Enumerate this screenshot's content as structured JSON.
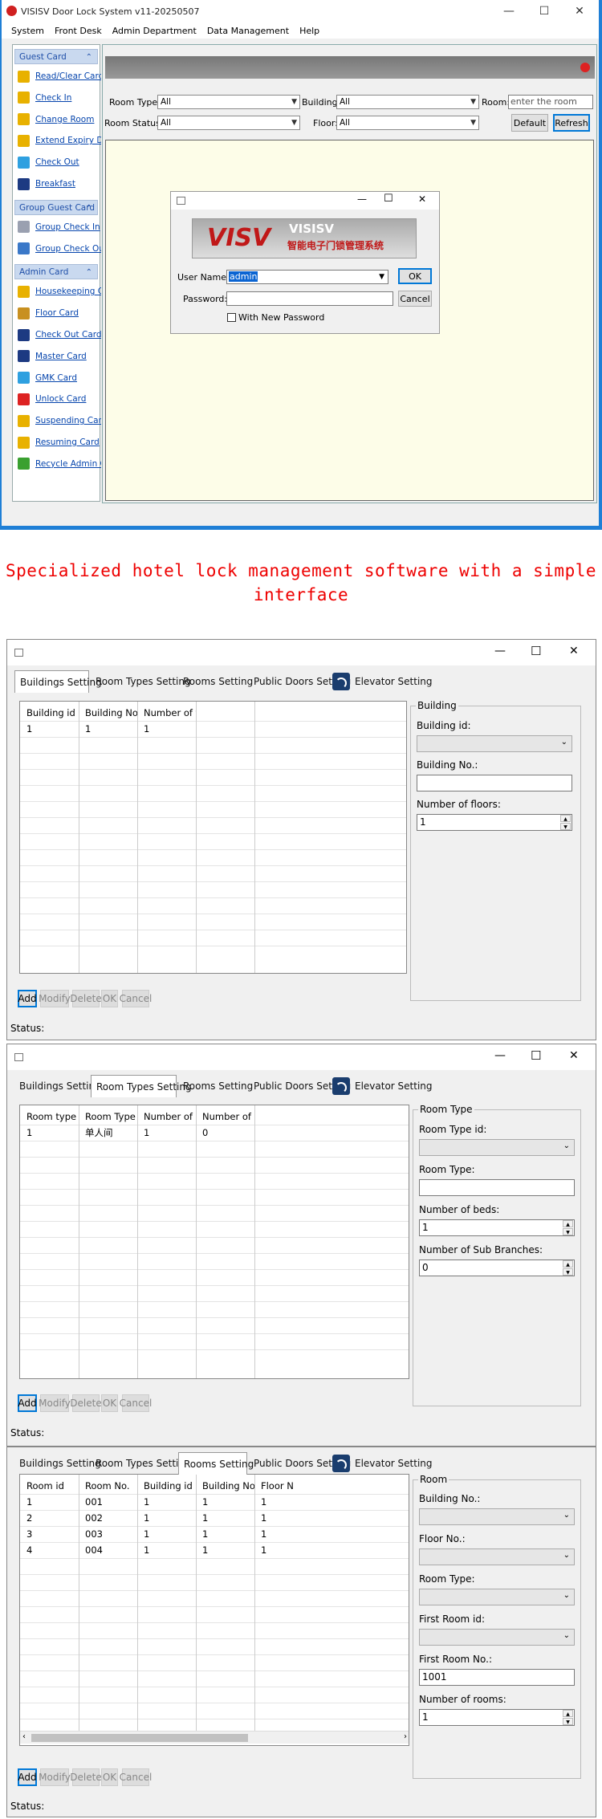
{
  "main_window": {
    "title": "VISISV Door Lock System v11-20250507",
    "menu": [
      "System",
      "Front Desk",
      "Admin Department",
      "Data Management",
      "Help"
    ]
  },
  "sidebar": {
    "sections": [
      {
        "title": "Guest Card",
        "items": [
          {
            "label": "Read/Clear Card",
            "icon": "folder-icon",
            "color": "#e8b100"
          },
          {
            "label": "Check In",
            "icon": "checkin-icon",
            "color": "#e8b100"
          },
          {
            "label": "Change Room",
            "icon": "change-room-icon",
            "color": "#e8b100"
          },
          {
            "label": "Extend Expiry Date",
            "icon": "extend-icon",
            "color": "#e8b100"
          },
          {
            "label": "Check Out",
            "icon": "checkout-icon",
            "color": "#2ea0e0"
          },
          {
            "label": "Breakfast",
            "icon": "breakfast-icon",
            "color": "#1d3a82"
          }
        ]
      },
      {
        "title": "Group Guest Card",
        "items": [
          {
            "label": "Group Check In",
            "icon": "group-checkin-icon",
            "color": "#9aa0b0"
          },
          {
            "label": "Group Check Out",
            "icon": "group-checkout-icon",
            "color": "#3a78c8"
          }
        ]
      },
      {
        "title": "Admin Card",
        "items": [
          {
            "label": "Housekeeping Card",
            "icon": "housekeeping-icon",
            "color": "#e8b100"
          },
          {
            "label": "Floor Card",
            "icon": "floor-card-icon",
            "color": "#c89020"
          },
          {
            "label": "Check Out Card",
            "icon": "checkout-card-icon",
            "color": "#1d3a82"
          },
          {
            "label": "Master Card",
            "icon": "master-card-icon",
            "color": "#1d3a82"
          },
          {
            "label": "GMK Card",
            "icon": "gmk-card-icon",
            "color": "#2ea0e0"
          },
          {
            "label": "Unlock Card",
            "icon": "unlock-card-icon",
            "color": "#d22"
          },
          {
            "label": "Suspending Card",
            "icon": "suspend-icon",
            "color": "#e8b100"
          },
          {
            "label": "Resuming Card",
            "icon": "resume-icon",
            "color": "#e8b100"
          },
          {
            "label": "Recycle Admin Card",
            "icon": "recycle-icon",
            "color": "#3aa030"
          }
        ]
      }
    ]
  },
  "filters": {
    "room_type_label": "Room Type:",
    "room_type_value": "All",
    "building_label": "Building:",
    "building_value": "All",
    "room_label": "Room:",
    "room_placeholder": "enter the room",
    "room_status_label": "Room Status:",
    "room_status_value": "All",
    "floor_label": "Floor:",
    "floor_value": "All",
    "default_btn": "Default",
    "refresh_btn": "Refresh"
  },
  "login": {
    "logo_brand": "VISISV",
    "logo_sub": "智能电子门锁管理系统",
    "user_label": "User Name:",
    "user_value": "admin",
    "password_label": "Password:",
    "ok_btn": "OK",
    "cancel_btn": "Cancel",
    "new_password_label": "With New Password"
  },
  "caption": "Specialized hotel lock management software with a simple interface",
  "tabs": [
    "Buildings Setting",
    "Room Types Setting",
    "Rooms Setting",
    "Public Doors Setting",
    "Elevator Setting"
  ],
  "buttons": [
    "Add",
    "Modify",
    "Delete",
    "OK",
    "Cancel"
  ],
  "status_label": "Status:",
  "buildings": {
    "columns": [
      "Building id",
      "Building No.",
      "Number of flo..."
    ],
    "rows": [
      [
        "1",
        "1",
        "1"
      ]
    ],
    "group_title": "Building",
    "field_building_id": "Building id:",
    "field_building_no": "Building No.:",
    "field_floors": "Number of floors:",
    "floors_value": "1"
  },
  "room_types": {
    "columns": [
      "Room type id",
      "Room Type",
      "Number of beds",
      "Number of Su..."
    ],
    "rows": [
      [
        "1",
        "单人间",
        "1",
        "0"
      ]
    ],
    "group_title": "Room Type",
    "field_id": "Room Type id:",
    "field_type": "Room Type:",
    "field_beds": "Number of beds:",
    "beds_value": "1",
    "field_sub": "Number of Sub Branches:",
    "sub_value": "0"
  },
  "rooms": {
    "columns": [
      "Room id",
      "Room No.",
      "Building id",
      "Building No.",
      "Floor N"
    ],
    "rows": [
      [
        "1",
        "001",
        "1",
        "1",
        "1"
      ],
      [
        "2",
        "002",
        "1",
        "1",
        "1"
      ],
      [
        "3",
        "003",
        "1",
        "1",
        "1"
      ],
      [
        "4",
        "004",
        "1",
        "1",
        "1"
      ]
    ],
    "group_title": "Room",
    "field_building_no": "Building No.:",
    "field_floor_no": "Floor No.:",
    "field_room_type": "Room Type:",
    "field_first_room_id": "First Room id:",
    "field_first_room_no": "First Room No.:",
    "first_room_no_value": "1001",
    "field_num_rooms": "Number of rooms:",
    "num_rooms_value": "1"
  }
}
